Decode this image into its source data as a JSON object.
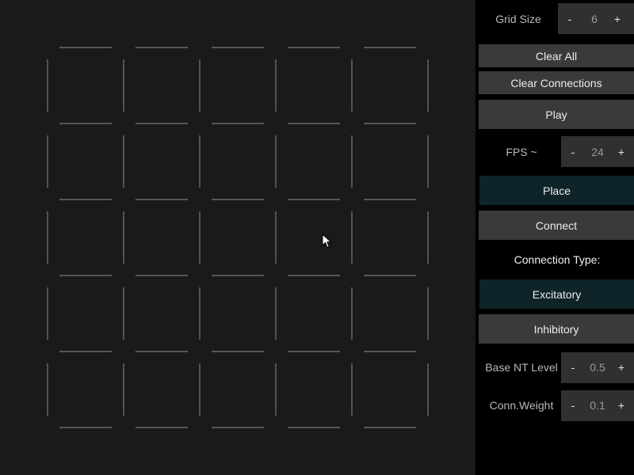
{
  "grid": {
    "size": 5
  },
  "controls": {
    "grid_size": {
      "label": "Grid Size",
      "minus": "-",
      "value": "6",
      "plus": "+"
    },
    "clear_all": "Clear All",
    "clear_connections": "Clear Connections",
    "play": "Play",
    "fps": {
      "label": "FPS ~",
      "minus": "-",
      "value": "24",
      "plus": "+"
    },
    "place": "Place",
    "connect": "Connect",
    "connection_type_heading": "Connection Type:",
    "excitatory": "Excitatory",
    "inhibitory": "Inhibitory",
    "base_nt_level": {
      "label": "Base NT Level",
      "minus": "-",
      "value": "0.5",
      "plus": "+"
    },
    "conn_weight": {
      "label": "Conn.Weight",
      "minus": "-",
      "value": "0.1",
      "plus": "+"
    }
  },
  "state": {
    "active_mode": "Place",
    "active_connection_type": "Excitatory"
  },
  "colors": {
    "background": "#1a1a1a",
    "panel": "#000000",
    "button": "#3a3a3a",
    "button_active": "#0e2429",
    "grid_line": "#7a7a7a"
  },
  "icons": {
    "cursor": "mouse-pointer-icon"
  }
}
